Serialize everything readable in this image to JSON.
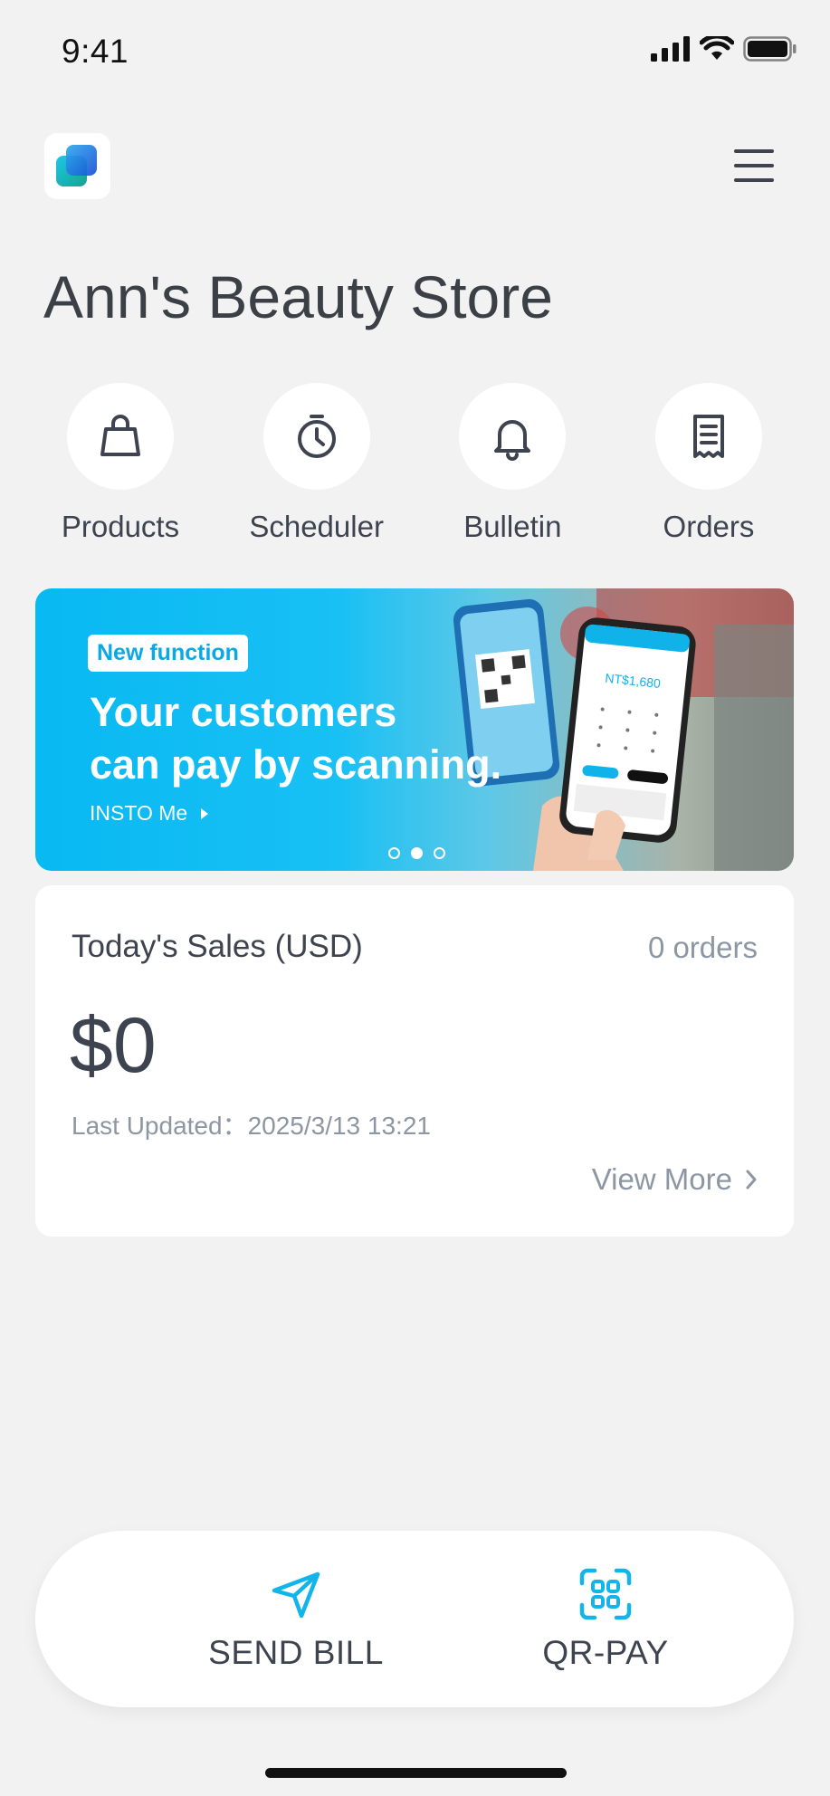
{
  "status_bar": {
    "time": "9:41"
  },
  "header": {
    "store_name": "Ann's Beauty Store"
  },
  "quick_actions": [
    {
      "label": "Products",
      "icon": "shopping-bag-icon"
    },
    {
      "label": "Scheduler",
      "icon": "stopwatch-icon"
    },
    {
      "label": "Bulletin",
      "icon": "bell-icon"
    },
    {
      "label": "Orders",
      "icon": "receipt-icon"
    }
  ],
  "banner": {
    "tag": "New function",
    "headline_line1": "Your customers",
    "headline_line2": "can pay by scanning.",
    "link": "INSTO Me",
    "phone_amount": "NT$1,680",
    "slide_count": 3,
    "active_slide": 2
  },
  "sales_card": {
    "title": "Today's Sales (USD)",
    "orders": "0 orders",
    "amount": "$0",
    "last_updated": "Last Updated：2025/3/13 13:21",
    "view_more": "View More"
  },
  "bottom_bar": {
    "send_bill": "SEND BILL",
    "qr_pay": "QR-PAY"
  },
  "colors": {
    "accent": "#12b5ea",
    "text": "#3d4450",
    "muted": "#8d96a3",
    "background": "#f2f2f3"
  }
}
